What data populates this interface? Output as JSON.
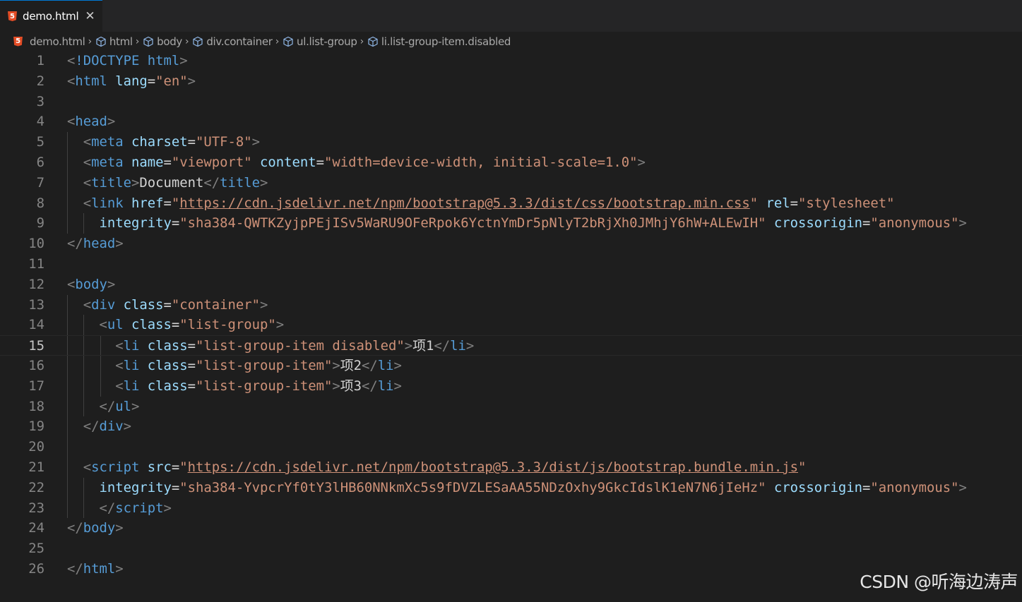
{
  "tab": {
    "title": "demo.html",
    "close": "✕"
  },
  "breadcrumb": [
    "demo.html",
    "html",
    "body",
    "div.container",
    "ul.list-group",
    "li.list-group-item.disabled"
  ],
  "editor": {
    "current_line": 15,
    "lines": [
      [
        [
          "punct",
          "<"
        ],
        [
          "tag",
          "!DOCTYPE "
        ],
        [
          "tagb",
          "html"
        ],
        [
          "punct",
          ">"
        ]
      ],
      [
        [
          "punct",
          "<"
        ],
        [
          "tag",
          "html "
        ],
        [
          "attr",
          "lang"
        ],
        [
          "eq",
          "="
        ],
        [
          "str",
          "\"en\""
        ],
        [
          "punct",
          ">"
        ]
      ],
      [],
      [
        [
          "punct",
          "<"
        ],
        [
          "tag",
          "head"
        ],
        [
          "punct",
          ">"
        ]
      ],
      [
        [
          "ind",
          "  "
        ],
        [
          "punct",
          "<"
        ],
        [
          "tag",
          "meta "
        ],
        [
          "attr",
          "charset"
        ],
        [
          "eq",
          "="
        ],
        [
          "str",
          "\"UTF-8\""
        ],
        [
          "punct",
          ">"
        ]
      ],
      [
        [
          "ind",
          "  "
        ],
        [
          "punct",
          "<"
        ],
        [
          "tag",
          "meta "
        ],
        [
          "attr",
          "name"
        ],
        [
          "eq",
          "="
        ],
        [
          "str",
          "\"viewport\" "
        ],
        [
          "attr",
          "content"
        ],
        [
          "eq",
          "="
        ],
        [
          "str",
          "\"width=device-width, initial-scale=1.0\""
        ],
        [
          "punct",
          ">"
        ]
      ],
      [
        [
          "ind",
          "  "
        ],
        [
          "punct",
          "<"
        ],
        [
          "tag",
          "title"
        ],
        [
          "punct",
          ">"
        ],
        [
          "text",
          "Document"
        ],
        [
          "punct",
          "</"
        ],
        [
          "tag",
          "title"
        ],
        [
          "punct",
          ">"
        ]
      ],
      [
        [
          "ind",
          "  "
        ],
        [
          "punct",
          "<"
        ],
        [
          "tag",
          "link "
        ],
        [
          "attr",
          "href"
        ],
        [
          "eq",
          "="
        ],
        [
          "str",
          "\""
        ],
        [
          "link",
          "https://cdn.jsdelivr.net/npm/bootstrap@5.3.3/dist/css/bootstrap.min.css"
        ],
        [
          "str",
          "\" "
        ],
        [
          "attr",
          "rel"
        ],
        [
          "eq",
          "="
        ],
        [
          "str",
          "\"stylesheet\""
        ]
      ],
      [
        [
          "ind",
          "    "
        ],
        [
          "attr",
          "integrity"
        ],
        [
          "eq",
          "="
        ],
        [
          "str",
          "\"sha384-QWTKZyjpPEjISv5WaRU9OFeRpok6YctnYmDr5pNlyT2bRjXh0JMhjY6hW+ALEwIH\" "
        ],
        [
          "attr",
          "crossorigin"
        ],
        [
          "eq",
          "="
        ],
        [
          "str",
          "\"anonymous\""
        ],
        [
          "punct",
          ">"
        ]
      ],
      [
        [
          "punct",
          "</"
        ],
        [
          "tag",
          "head"
        ],
        [
          "punct",
          ">"
        ]
      ],
      [],
      [
        [
          "punct",
          "<"
        ],
        [
          "tag",
          "body"
        ],
        [
          "punct",
          ">"
        ]
      ],
      [
        [
          "ind",
          "  "
        ],
        [
          "punct",
          "<"
        ],
        [
          "tag",
          "div "
        ],
        [
          "attr",
          "class"
        ],
        [
          "eq",
          "="
        ],
        [
          "str",
          "\"container\""
        ],
        [
          "punct",
          ">"
        ]
      ],
      [
        [
          "ind",
          "    "
        ],
        [
          "punct",
          "<"
        ],
        [
          "tag",
          "ul "
        ],
        [
          "attr",
          "class"
        ],
        [
          "eq",
          "="
        ],
        [
          "str",
          "\"list-group\""
        ],
        [
          "punct",
          ">"
        ]
      ],
      [
        [
          "ind",
          "      "
        ],
        [
          "punct",
          "<"
        ],
        [
          "tag",
          "li "
        ],
        [
          "attr",
          "class"
        ],
        [
          "eq",
          "="
        ],
        [
          "str",
          "\"list-group-item disabled\""
        ],
        [
          "punct",
          ">"
        ],
        [
          "text",
          "项1"
        ],
        [
          "punct",
          "</"
        ],
        [
          "tag",
          "li"
        ],
        [
          "punct",
          ">"
        ]
      ],
      [
        [
          "ind",
          "      "
        ],
        [
          "punct",
          "<"
        ],
        [
          "tag",
          "li "
        ],
        [
          "attr",
          "class"
        ],
        [
          "eq",
          "="
        ],
        [
          "str",
          "\"list-group-item\""
        ],
        [
          "punct",
          ">"
        ],
        [
          "text",
          "项2"
        ],
        [
          "punct",
          "</"
        ],
        [
          "tag",
          "li"
        ],
        [
          "punct",
          ">"
        ]
      ],
      [
        [
          "ind",
          "      "
        ],
        [
          "punct",
          "<"
        ],
        [
          "tag",
          "li "
        ],
        [
          "attr",
          "class"
        ],
        [
          "eq",
          "="
        ],
        [
          "str",
          "\"list-group-item\""
        ],
        [
          "punct",
          ">"
        ],
        [
          "text",
          "项3"
        ],
        [
          "punct",
          "</"
        ],
        [
          "tag",
          "li"
        ],
        [
          "punct",
          ">"
        ]
      ],
      [
        [
          "ind",
          "    "
        ],
        [
          "punct",
          "</"
        ],
        [
          "tag",
          "ul"
        ],
        [
          "punct",
          ">"
        ]
      ],
      [
        [
          "ind",
          "  "
        ],
        [
          "punct",
          "</"
        ],
        [
          "tag",
          "div"
        ],
        [
          "punct",
          ">"
        ]
      ],
      [],
      [
        [
          "ind",
          "  "
        ],
        [
          "punct",
          "<"
        ],
        [
          "tag",
          "script "
        ],
        [
          "attr",
          "src"
        ],
        [
          "eq",
          "="
        ],
        [
          "str",
          "\""
        ],
        [
          "link",
          "https://cdn.jsdelivr.net/npm/bootstrap@5.3.3/dist/js/bootstrap.bundle.min.js"
        ],
        [
          "str",
          "\""
        ]
      ],
      [
        [
          "ind",
          "    "
        ],
        [
          "attr",
          "integrity"
        ],
        [
          "eq",
          "="
        ],
        [
          "str",
          "\"sha384-YvpcrYf0tY3lHB60NNkmXc5s9fDVZLESaAA55NDzOxhy9GkcIdslK1eN7N6jIeHz\" "
        ],
        [
          "attr",
          "crossorigin"
        ],
        [
          "eq",
          "="
        ],
        [
          "str",
          "\"anonymous\""
        ],
        [
          "punct",
          ">"
        ]
      ],
      [
        [
          "ind",
          "    "
        ],
        [
          "punct",
          "</"
        ],
        [
          "tag",
          "script"
        ],
        [
          "punct",
          ">"
        ]
      ],
      [
        [
          "punct",
          "</"
        ],
        [
          "tag",
          "body"
        ],
        [
          "punct",
          ">"
        ]
      ],
      [],
      [
        [
          "punct",
          "</"
        ],
        [
          "tag",
          "html"
        ],
        [
          "punct",
          ">"
        ]
      ]
    ],
    "guides": [
      [],
      [],
      [],
      [],
      [
        1
      ],
      [
        1
      ],
      [
        1
      ],
      [
        1
      ],
      [
        1,
        2
      ],
      [],
      [],
      [],
      [
        1
      ],
      [
        1,
        2
      ],
      [
        1,
        2,
        3
      ],
      [
        1,
        2,
        3
      ],
      [
        1,
        2,
        3
      ],
      [
        1,
        2
      ],
      [
        1
      ],
      [
        1
      ],
      [
        1
      ],
      [
        1,
        2
      ],
      [
        1,
        2
      ],
      [],
      [],
      []
    ]
  },
  "watermark": "CSDN @听海边涛声",
  "colors": {
    "background": "#1e1e1e",
    "tag": "#569cd6",
    "attribute": "#9cdcfe",
    "string": "#ce9178",
    "punctuation": "#808080",
    "html5_badge": "#e44d26"
  }
}
